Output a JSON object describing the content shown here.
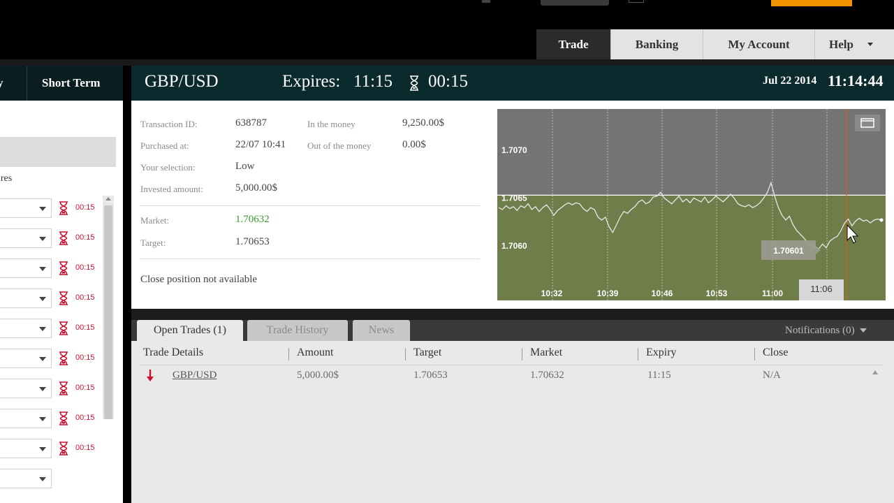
{
  "nav": {
    "tabs": [
      {
        "label": "Trade",
        "active": true
      },
      {
        "label": "Banking",
        "active": false
      },
      {
        "label": "My Account",
        "active": false
      },
      {
        "label": "Help",
        "active": false
      }
    ]
  },
  "left": {
    "tabs": [
      {
        "label": "y"
      },
      {
        "label": "Short Term"
      }
    ],
    "expires_label": "ires",
    "rows": [
      {
        "time": "00:15"
      },
      {
        "time": "00:15"
      },
      {
        "time": "00:15"
      },
      {
        "time": "00:15"
      },
      {
        "time": "00:15"
      },
      {
        "time": "00:15"
      },
      {
        "time": "00:15"
      },
      {
        "time": "00:15"
      },
      {
        "time": "00:15"
      },
      {
        "time": ""
      }
    ]
  },
  "header": {
    "pair": "GBP/USD",
    "expires_label": "Expires:",
    "expires_time": "11:15",
    "countdown": "00:15",
    "date": "Jul 22 2014",
    "time": "11:14:44"
  },
  "details": {
    "transaction_id_label": "Transaction ID:",
    "transaction_id": "638787",
    "purchased_label": "Purchased at:",
    "purchased": "22/07 10:41",
    "selection_label": "Your selection:",
    "selection": "Low",
    "invested_label": "Invested amount:",
    "invested": "5,000.00$",
    "in_money_label": "In the money",
    "in_money": "9,250.00$",
    "out_money_label": "Out of the money",
    "out_money": "0.00$",
    "market_label": "Market:",
    "market": "1.70632",
    "target_label": "Target:",
    "target": "1.70653",
    "close_note": "Close position not available"
  },
  "chart_data": {
    "type": "line",
    "y_tick_labels": [
      "1.7070",
      "1.7065",
      "1.7060"
    ],
    "y_ticks": [
      1.707,
      1.7065,
      1.706
    ],
    "x_tick_labels": [
      "10:32",
      "10:39",
      "10:46",
      "10:53",
      "11:00"
    ],
    "target_level": 1.70653,
    "current_label": "1.70601",
    "cursor_time_label": "11:06",
    "colors": {
      "upper_zone": "#747474",
      "lower_zone": "#6f7d4a",
      "line": "#e8e8e8",
      "expiry_line": "#e06010"
    },
    "series": [
      {
        "values": [
          1.7064,
          1.70638,
          1.70642,
          1.70639,
          1.70641,
          1.70637,
          1.70642,
          1.7064,
          1.70644,
          1.70638,
          1.70641,
          1.70636,
          1.7064,
          1.70643,
          1.70638,
          1.70632,
          1.70637,
          1.7064,
          1.70643,
          1.70645,
          1.70643,
          1.70645,
          1.70644,
          1.70639,
          1.70636,
          1.7064,
          1.70638,
          1.7063,
          1.70627,
          1.7063,
          1.7062,
          1.70614,
          1.70622,
          1.7063,
          1.70636,
          1.70634,
          1.70638,
          1.70641,
          1.70646,
          1.70648,
          1.70644,
          1.70646,
          1.70651,
          1.70652,
          1.70656,
          1.7065,
          1.70647,
          1.70644,
          1.70648,
          1.70652,
          1.70646,
          1.70649,
          1.70645,
          1.7065,
          1.70648,
          1.70646,
          1.70651,
          1.70645,
          1.70648,
          1.70652,
          1.70649,
          1.70646,
          1.7065,
          1.70654,
          1.7065,
          1.70644,
          1.70642,
          1.70641,
          1.70643,
          1.7064,
          1.70642,
          1.70645,
          1.7065,
          1.70656,
          1.70666,
          1.70652,
          1.7064,
          1.70632,
          1.70627,
          1.70631,
          1.70622,
          1.70616,
          1.70612,
          1.70608,
          1.70603,
          1.70601,
          1.70599,
          1.70597,
          1.70602,
          1.70598,
          1.70605,
          1.70608,
          1.7061,
          1.70616,
          1.70624,
          1.70628,
          1.70621,
          1.70626,
          1.70629,
          1.70626,
          1.70627,
          1.70624,
          1.70627,
          1.70628,
          1.70627
        ]
      }
    ]
  },
  "bottom": {
    "tabs": [
      {
        "label": "Open Trades (1)",
        "active": true
      },
      {
        "label": "Trade History",
        "active": false
      },
      {
        "label": "News",
        "active": false
      }
    ],
    "notifications": "Notifications (0)",
    "columns": [
      "Trade Details",
      "Amount",
      "Target",
      "Market",
      "Expiry",
      "Close"
    ],
    "rows": [
      {
        "asset": "GBP/USD",
        "amount": "5,000.00$",
        "target": "1.70653",
        "market": "1.70632",
        "expiry": "11:15",
        "close": "N/A",
        "direction": "down"
      }
    ]
  }
}
